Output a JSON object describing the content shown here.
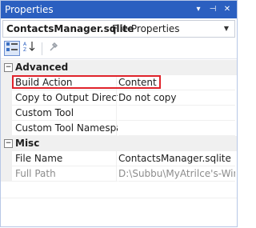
{
  "window": {
    "title": "Properties",
    "pin_glyph": "▾",
    "autohide_glyph": "⊣",
    "close_glyph": "✕"
  },
  "object_selector": {
    "name": "ContactsManager.sqlite",
    "type": "File Properties"
  },
  "toolbar": {
    "categorized_icon": "categorized-icon",
    "alphabetical_icon": "alphabetical-icon",
    "property_pages_icon": "property-pages-icon"
  },
  "grid": {
    "categories": [
      {
        "label": "Advanced",
        "properties": [
          {
            "name": "Build Action",
            "value": "Content"
          },
          {
            "name": "Copy to Output Directo",
            "value": "Do not copy"
          },
          {
            "name": "Custom Tool",
            "value": ""
          },
          {
            "name": "Custom Tool Namespac",
            "value": ""
          }
        ]
      },
      {
        "label": "Misc",
        "properties": [
          {
            "name": "File Name",
            "value": "ContactsManager.sqlite"
          },
          {
            "name": "Full Path",
            "value": "D:\\Subbu\\MyAtrilce's-Wind"
          }
        ]
      }
    ]
  },
  "colors": {
    "titlebar": "#2b5fc0",
    "highlight": "#e0232b"
  }
}
